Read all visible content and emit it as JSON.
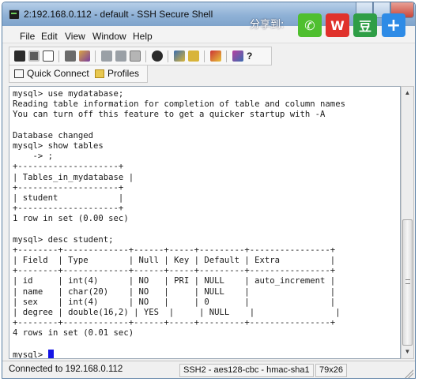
{
  "window": {
    "title": "2:192.168.0.112 - default - SSH Secure Shell"
  },
  "share": {
    "label": "分享到:",
    "buttons": [
      {
        "icon": "wechat-icon",
        "glyph": "✆",
        "color": "#4fbf2f"
      },
      {
        "icon": "weibo-icon",
        "glyph": "W",
        "color": "#e0322c"
      },
      {
        "icon": "douban-icon",
        "glyph": "豆",
        "color": "#2f9e46"
      },
      {
        "icon": "plus-icon",
        "glyph": "+",
        "color": "#2e8be6"
      }
    ]
  },
  "menu": {
    "items": [
      "File",
      "Edit",
      "View",
      "Window",
      "Help"
    ]
  },
  "quick": {
    "connect_label": "Quick Connect",
    "profiles_label": "Profiles"
  },
  "terminal": {
    "lines": [
      "mysql> use mydatabase;",
      "Reading table information for completion of table and column names",
      "You can turn off this feature to get a quicker startup with -A",
      "",
      "Database changed",
      "mysql> show tables",
      "    -> ;",
      "+--------------------+",
      "| Tables_in_mydatabase |",
      "+--------------------+",
      "| student            |",
      "+--------------------+",
      "1 row in set (0.00 sec)",
      "",
      "mysql> desc student;",
      "+--------+-------------+------+-----+---------+----------------+",
      "| Field  | Type        | Null | Key | Default | Extra          |",
      "+--------+-------------+------+-----+---------+----------------+",
      "| id     | int(4)      | NO   | PRI | NULL    | auto_increment |",
      "| name   | char(20)    | NO   |     | NULL    |                |",
      "| sex    | int(4)      | NO   |     | 0       |                |",
      "| degree | double(16,2) | YES  |     | NULL    |                |",
      "+--------+-------------+------+-----+---------+----------------+",
      "4 rows in set (0.01 sec)",
      ""
    ],
    "prompt": "mysql> "
  },
  "status": {
    "connection": "Connected to 192.168.0.112",
    "cipher": "SSH2 - aes128-cbc - hmac-sha1",
    "size": "79x26"
  }
}
